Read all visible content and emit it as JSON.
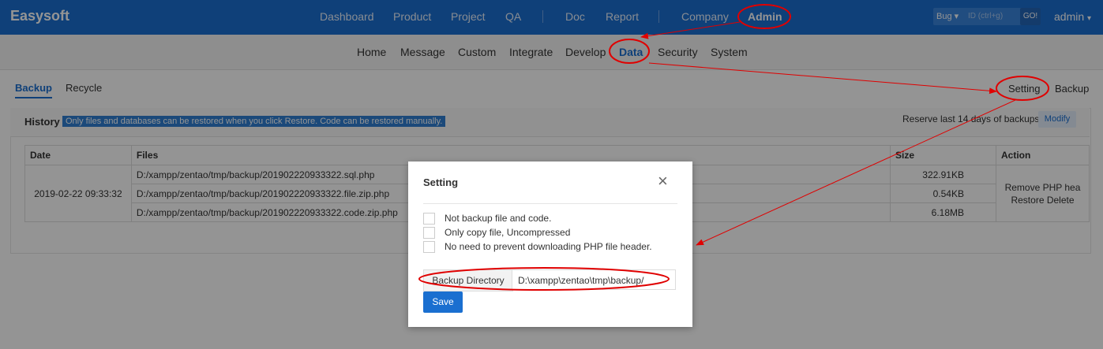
{
  "header": {
    "brand": "Easysoft",
    "nav": [
      "Dashboard",
      "Product",
      "Project",
      "QA",
      "Doc",
      "Report",
      "Company",
      "Admin"
    ],
    "search_type": "Bug",
    "search_placeholder": "ID (ctrl+g)",
    "go_label": "GO!",
    "user": "admin"
  },
  "subnav": [
    "Home",
    "Message",
    "Custom",
    "Integrate",
    "Develop",
    "Data",
    "Security",
    "System"
  ],
  "tabs": {
    "backup": "Backup",
    "recycle": "Recycle"
  },
  "actions_right": {
    "setting": "Setting",
    "backup": "Backup"
  },
  "history": {
    "title": "History",
    "notice": "Only files and databases can be restored when you click Restore. Code can be restored manually.",
    "reserve_text": "Reserve last 14 days of backups",
    "modify_label": "Modify"
  },
  "table": {
    "headers": [
      "Date",
      "Files",
      "Size",
      "Action"
    ],
    "date": "2019-02-22 09:33:32",
    "files": [
      {
        "name": "D:/xampp/zentao/tmp/backup/201902220933322.sql.php",
        "size": "322.91KB"
      },
      {
        "name": "D:/xampp/zentao/tmp/backup/201902220933322.file.zip.php",
        "size": "0.54KB"
      },
      {
        "name": "D:/xampp/zentao/tmp/backup/201902220933322.code.zip.php",
        "size": "6.18MB"
      }
    ],
    "action_line1": "Remove PHP hea",
    "action_line2": "Restore Delete"
  },
  "modal": {
    "title": "Setting",
    "close_symbol": "×",
    "options": [
      "Not backup file and code.",
      "Only copy file, Uncompressed",
      "No need to prevent downloading PHP file header."
    ],
    "dir_label": "Backup Directory",
    "dir_value": "D:\\xampp\\zentao\\tmp\\backup/",
    "save_label": "Save"
  },
  "colors": {
    "primary": "#1a6fd0",
    "annotation": "#e00000"
  }
}
